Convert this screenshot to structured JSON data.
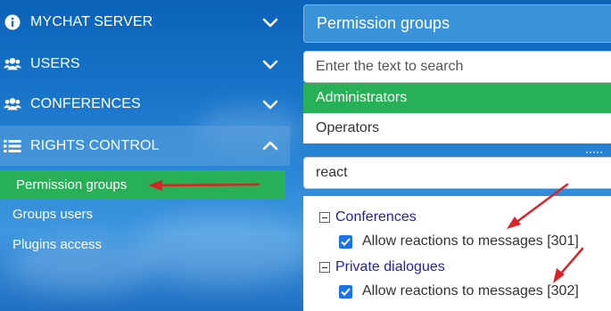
{
  "sidebar": {
    "sections": [
      {
        "label": "MYCHAT SERVER",
        "icon": "info-icon"
      },
      {
        "label": "USERS",
        "icon": "users-icon"
      },
      {
        "label": "CONFERENCES",
        "icon": "users-icon"
      },
      {
        "label": "RIGHTS CONTROL",
        "icon": "list-icon"
      }
    ],
    "rights_items": [
      {
        "label": "Permission groups",
        "selected": true
      },
      {
        "label": "Groups users"
      },
      {
        "label": "Plugins access"
      }
    ]
  },
  "panel": {
    "title": "Permission groups",
    "search_placeholder": "Enter the text to search",
    "groups": [
      {
        "label": "Administrators",
        "selected": true
      },
      {
        "label": "Operators"
      }
    ],
    "filter_value": "react",
    "tree": [
      {
        "title": "Conferences",
        "items": [
          {
            "label": "Allow reactions to messages [301]",
            "checked": true
          }
        ]
      },
      {
        "title": "Private dialogues",
        "items": [
          {
            "label": "Allow reactions to messages [302]",
            "checked": true
          }
        ]
      }
    ]
  },
  "colors": {
    "accent_green": "#27b056",
    "panel_blue": "#3a93d9",
    "annotation_red": "#d9232a",
    "checkbox_blue": "#1a73e8"
  }
}
